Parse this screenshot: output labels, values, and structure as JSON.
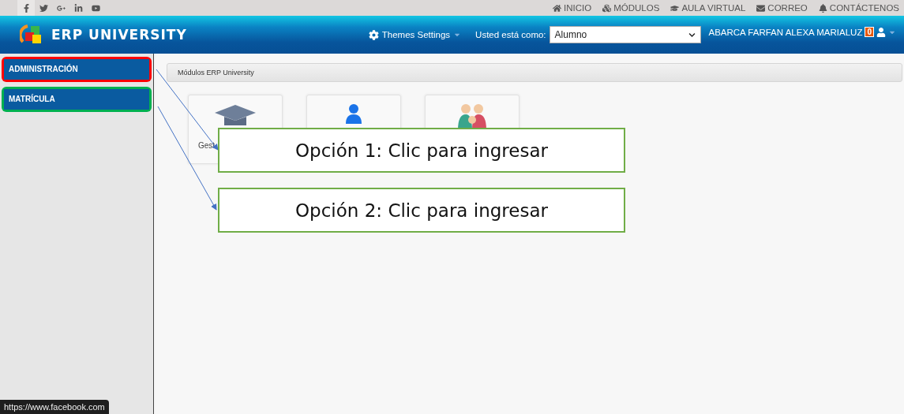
{
  "social_links": [
    {
      "kind": "facebook",
      "selected": true
    },
    {
      "kind": "twitter",
      "selected": false
    },
    {
      "kind": "googleplus",
      "selected": false
    },
    {
      "kind": "linkedin",
      "selected": false
    },
    {
      "kind": "youtube",
      "selected": false
    }
  ],
  "top_nav": [
    {
      "kind": "home",
      "label": "INICIO"
    },
    {
      "kind": "cubes",
      "label": "MÓDULOS"
    },
    {
      "kind": "cap",
      "label": "AULA VIRTUAL"
    },
    {
      "kind": "mail",
      "label": "CORREO"
    },
    {
      "kind": "bell",
      "label": "CONTÁCTENOS"
    }
  ],
  "header": {
    "logo_text": "ERP UNIVERSITY",
    "themes_label": "Themes Settings",
    "role_label": "Usted está como:",
    "role_value": "Alumno",
    "user_name": "ABARCA FARFAN ALEXA MARIALUZ",
    "badge": "0"
  },
  "sidebar": {
    "items": [
      {
        "label": "ADMINISTRACIÓN",
        "color": "#ff0000"
      },
      {
        "label": "MATRÍCULA",
        "color": "#00b050"
      }
    ]
  },
  "breadcrumb": "Módulos ERP University",
  "modules": [
    {
      "kind": "cap",
      "label": "Gest"
    },
    {
      "kind": "user"
    },
    {
      "kind": "family"
    }
  ],
  "callouts": [
    "Opción 1: Clic para ingresar",
    "Opción 2: Clic para ingresar"
  ],
  "status_url": "https://www.facebook.com"
}
